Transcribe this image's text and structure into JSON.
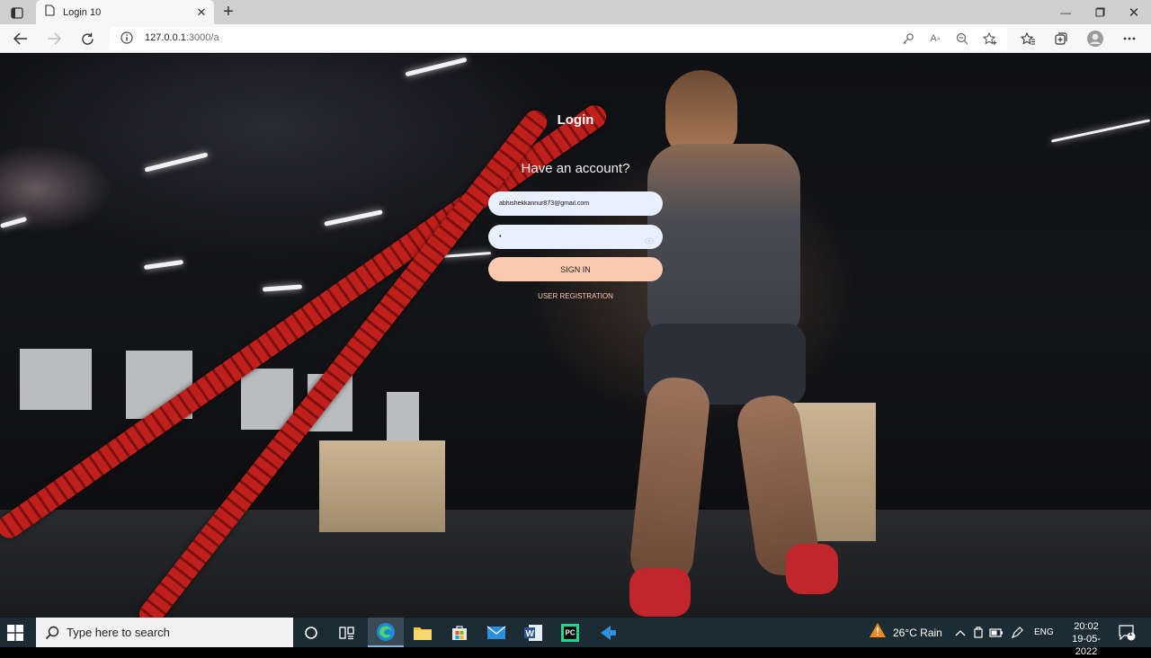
{
  "browser": {
    "tab_title": "Login 10",
    "url_host": "127.0.0.1",
    "url_path": ":3000/a"
  },
  "login": {
    "title": "Login",
    "subtitle": "Have an account?",
    "email_value": "abhishekkannur873@gmail.com",
    "password_value": "•",
    "signin_label": "SIGN IN",
    "register_label": "USER REGISTRATION"
  },
  "taskbar": {
    "search_placeholder": "Type here to search",
    "weather": "26°C  Rain",
    "language": "ENG",
    "time": "20:02",
    "date": "19-05-2022",
    "notification_count": "1"
  },
  "colors": {
    "signin_bg": "#fbc9b0",
    "field_bg": "#e8effd",
    "taskbar_bg": "#1d2b34"
  }
}
